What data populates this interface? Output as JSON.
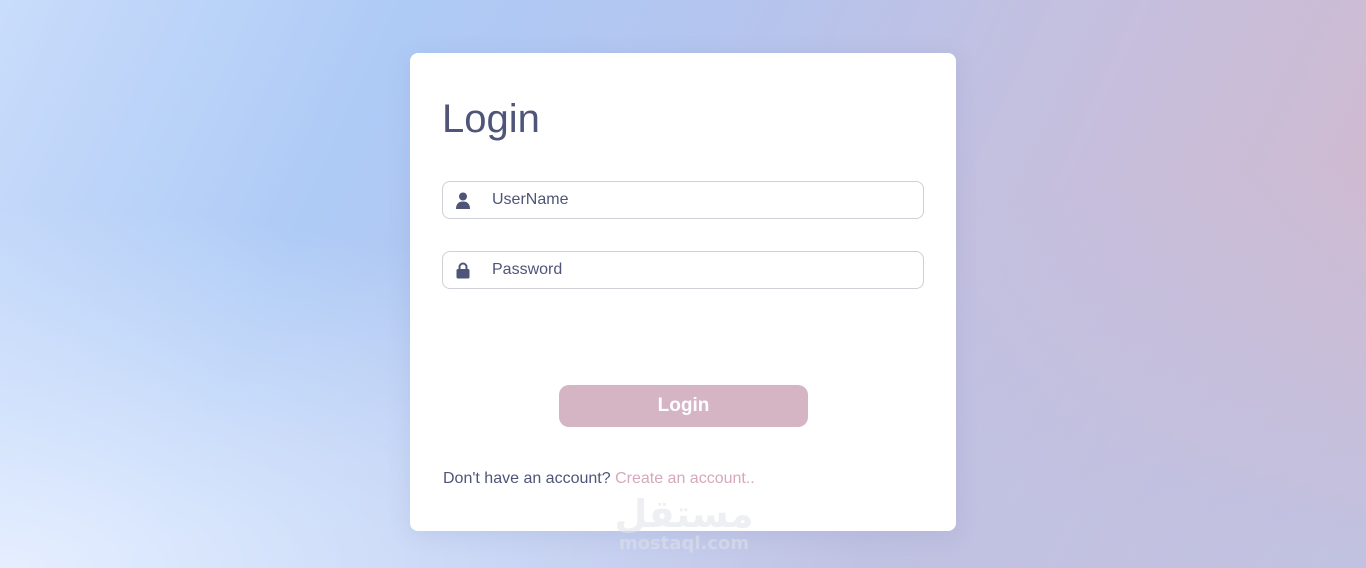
{
  "login": {
    "title": "Login",
    "username_placeholder": "UserName",
    "password_placeholder": "Password",
    "submit_label": "Login",
    "signup_prompt": "Don't have an account?",
    "signup_link": "Create an account.."
  },
  "icons": {
    "username": "user-icon",
    "password": "lock-icon"
  },
  "watermark": {
    "arabic": "مستقل",
    "latin": "mostaql.com"
  },
  "colors": {
    "text": "#4e5578",
    "button_bg": "#d5b4c4",
    "link": "#d5a8bd",
    "card_bg": "#ffffff"
  }
}
